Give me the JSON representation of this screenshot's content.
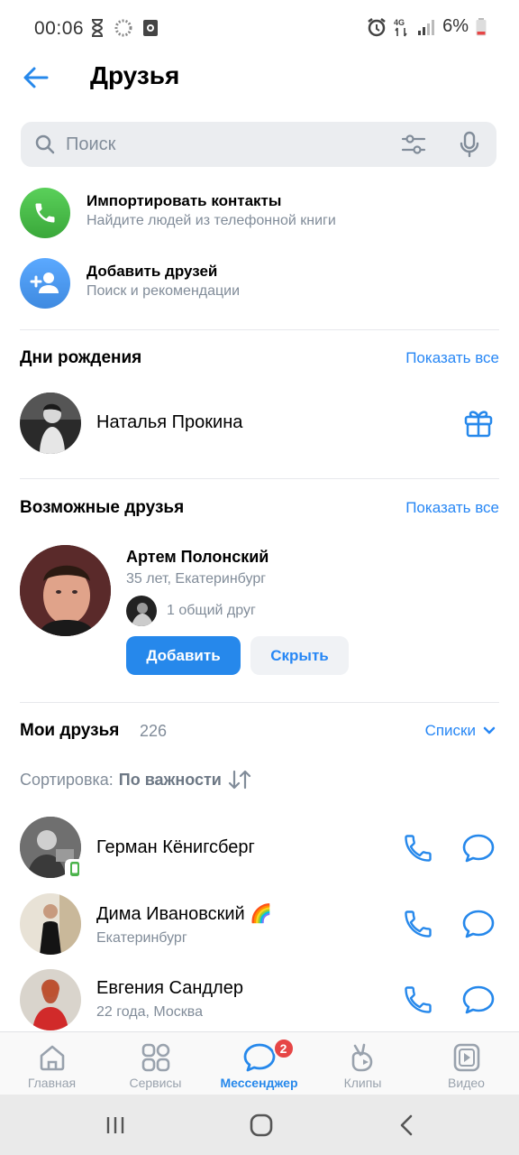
{
  "status_bar": {
    "time": "00:06",
    "battery": "6%",
    "network": "4G"
  },
  "header": {
    "title": "Друзья"
  },
  "search": {
    "placeholder": "Поиск"
  },
  "actions": [
    {
      "title": "Импортировать контакты",
      "subtitle": "Найдите людей из телефонной книги",
      "color": "#4bb34b"
    },
    {
      "title": "Добавить друзей",
      "subtitle": "Поиск и рекомендации",
      "color": "#3f8ae0"
    }
  ],
  "birthdays": {
    "title": "Дни рождения",
    "show_all": "Показать все",
    "person": {
      "name": "Наталья Прокина"
    }
  },
  "possible_friends": {
    "title": "Возможные друзья",
    "show_all": "Показать все",
    "person": {
      "name": "Артем Полонский",
      "info": "35 лет, Екатеринбург",
      "mutual": "1 общий друг",
      "add_label": "Добавить",
      "hide_label": "Скрыть"
    }
  },
  "my_friends": {
    "title": "Мои друзья",
    "count": "226",
    "lists_label": "Списки",
    "sort_prefix": "Сортировка:",
    "sort_value": "По важности",
    "items": [
      {
        "name": "Герман Кёнигсберг",
        "subtitle": "",
        "online_mobile": true
      },
      {
        "name": "Дима Ивановский 🌈",
        "subtitle": "Екатеринбург",
        "online_mobile": false
      },
      {
        "name": "Евгения Сандлер",
        "subtitle": "22 года, Москва",
        "online_mobile": false
      }
    ]
  },
  "tabbar": {
    "tabs": [
      {
        "label": "Главная",
        "icon": "home-icon"
      },
      {
        "label": "Сервисы",
        "icon": "services-icon"
      },
      {
        "label": "Мессенджер",
        "icon": "messenger-icon",
        "badge": "2",
        "active": true
      },
      {
        "label": "Клипы",
        "icon": "clips-icon"
      },
      {
        "label": "Видео",
        "icon": "video-icon"
      }
    ]
  },
  "colors": {
    "accent": "#2688eb",
    "link": "#2787f5",
    "secondary_text": "#818c99",
    "badge": "#e64646"
  }
}
